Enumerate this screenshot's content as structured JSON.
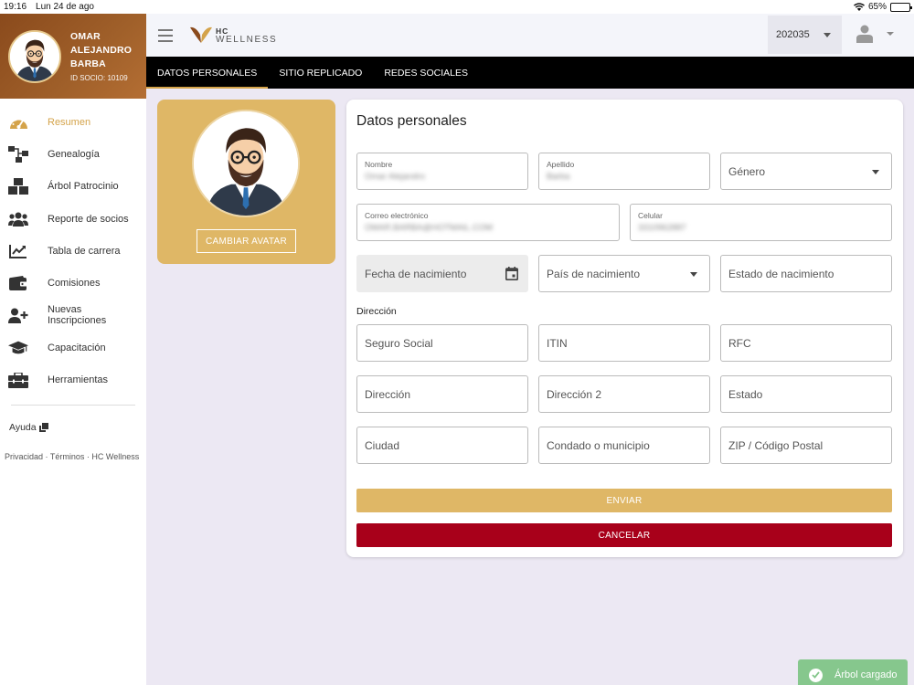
{
  "status": {
    "time": "19:16",
    "date": "Lun 24 de ago",
    "battery": "65%",
    "battery_level": 0.65
  },
  "profile": {
    "name": "OMAR ALEJANDRO BARBA",
    "id_label": "ID SOCIO: 10109"
  },
  "sidebar": {
    "items": [
      {
        "label": "Resumen",
        "icon": "speedometer-icon",
        "active": true
      },
      {
        "label": "Genealogía",
        "icon": "sitemap-icon",
        "active": false
      },
      {
        "label": "Árbol Patrocinio",
        "icon": "boxes-icon",
        "active": false
      },
      {
        "label": "Reporte de socios",
        "icon": "users-icon",
        "active": false
      },
      {
        "label": "Tabla de carrera",
        "icon": "chart-line-icon",
        "active": false
      },
      {
        "label": "Comisiones",
        "icon": "wallet-icon",
        "active": false
      },
      {
        "label": "Nuevas Inscripciones",
        "icon": "user-plus-icon",
        "active": false
      },
      {
        "label": "Capacitación",
        "icon": "graduation-cap-icon",
        "active": false
      },
      {
        "label": "Herramientas",
        "icon": "toolbox-icon",
        "active": false
      }
    ],
    "help": "Ayuda",
    "legal": "Privacidad · Términos · HC Wellness"
  },
  "header": {
    "logo_line1": "HC",
    "logo_line2": "WELLNESS",
    "period": "202035"
  },
  "tabs": [
    {
      "label": "DATOS PERSONALES",
      "active": true
    },
    {
      "label": "SITIO REPLICADO",
      "active": false
    },
    {
      "label": "REDES SOCIALES",
      "active": false
    }
  ],
  "avatar_card": {
    "change_label": "CAMBIAR AVATAR"
  },
  "form": {
    "title": "Datos personales",
    "nombre": {
      "label": "Nombre",
      "value": "Omar Alejandro"
    },
    "apellido": {
      "label": "Apellido",
      "value": "Barba"
    },
    "genero": {
      "placeholder": "Género"
    },
    "correo": {
      "label": "Correo electrónico",
      "value": "OMAR.BARBA@HOTMAIL.COM"
    },
    "celular": {
      "label": "Celular",
      "value": "3310962887"
    },
    "fecha": {
      "placeholder": "Fecha de nacimiento"
    },
    "pais": {
      "placeholder": "País de nacimiento"
    },
    "estado_nac": {
      "placeholder": "Estado de nacimiento"
    },
    "direccion_label": "Dirección",
    "seguro": {
      "placeholder": "Seguro Social"
    },
    "itin": {
      "placeholder": "ITIN"
    },
    "rfc": {
      "placeholder": "RFC"
    },
    "direccion": {
      "placeholder": "Dirección"
    },
    "direccion2": {
      "placeholder": "Dirección 2"
    },
    "estado": {
      "placeholder": "Estado"
    },
    "ciudad": {
      "placeholder": "Ciudad"
    },
    "condado": {
      "placeholder": "Condado o municipio"
    },
    "zip": {
      "placeholder": "ZIP / Código Postal"
    },
    "send_label": "ENVIAR",
    "cancel_label": "CANCELAR"
  },
  "toast": {
    "text": "Árbol cargado"
  },
  "colors": {
    "gold": "#dfb766",
    "gold_text": "#d4a34a",
    "brown": "#8a4a1c",
    "red": "#a8001a",
    "green": "#86c78d"
  }
}
